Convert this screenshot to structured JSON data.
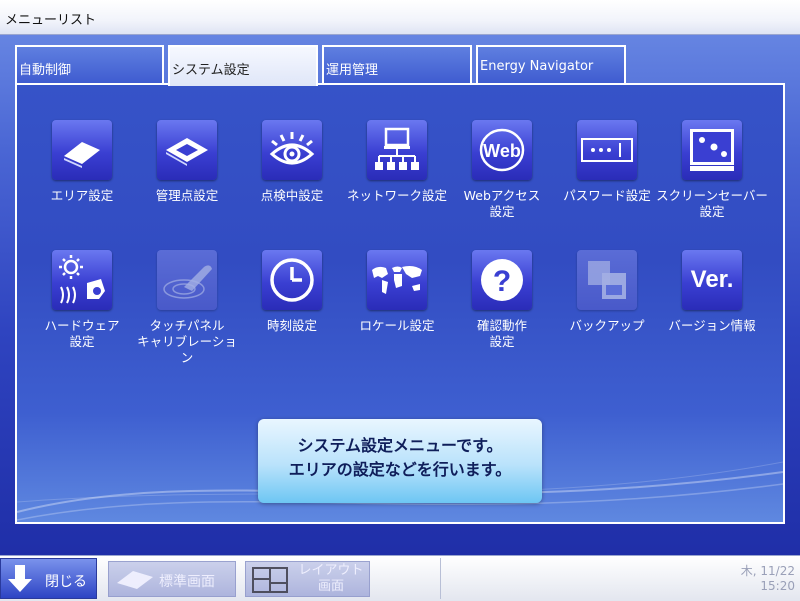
{
  "window": {
    "title": "メニューリスト"
  },
  "tabs": [
    {
      "label": "自動制御",
      "active": false
    },
    {
      "label": "システム設定",
      "active": true
    },
    {
      "label": "運用管理",
      "active": false
    },
    {
      "label": "Energy Navigator",
      "active": false
    }
  ],
  "menu_items": [
    {
      "label": "エリア設定",
      "icon": "area-setting-icon",
      "enabled": true
    },
    {
      "label": "管理点設定",
      "icon": "management-point-icon",
      "enabled": true
    },
    {
      "label": "点検中設定",
      "icon": "inspection-eye-icon",
      "enabled": true
    },
    {
      "label": "ネットワーク設定",
      "icon": "network-icon",
      "enabled": true
    },
    {
      "label": "Webアクセス\n設定",
      "icon": "web-icon",
      "enabled": true
    },
    {
      "label": "パスワード設定",
      "icon": "password-icon",
      "enabled": true
    },
    {
      "label": "スクリーンセーバー\n設定",
      "icon": "screensaver-icon",
      "enabled": true
    },
    {
      "label": "ハードウェア\n設定",
      "icon": "hardware-icon",
      "enabled": true
    },
    {
      "label": "タッチパネル\nキャリブレーション",
      "icon": "touch-calibration-icon",
      "enabled": false
    },
    {
      "label": "時刻設定",
      "icon": "clock-icon",
      "enabled": true
    },
    {
      "label": "ロケール設定",
      "icon": "world-map-icon",
      "enabled": true
    },
    {
      "label": "確認動作\n設定",
      "icon": "question-icon",
      "enabled": true
    },
    {
      "label": "バックアップ",
      "icon": "backup-icon",
      "enabled": false
    },
    {
      "label": "バージョン情報",
      "icon": "version-icon",
      "enabled": true
    },
    {
      "icon_text": "Ver."
    }
  ],
  "message": {
    "line1": "システム設定メニューです。",
    "line2": "エリアの設定などを行います。"
  },
  "footer": {
    "close_label": "閉じる",
    "standard_screen_label": "標準画面",
    "layout_screen_label": "レイアウト\n画面",
    "day_date": "木, 11/22",
    "time": "15:20"
  }
}
